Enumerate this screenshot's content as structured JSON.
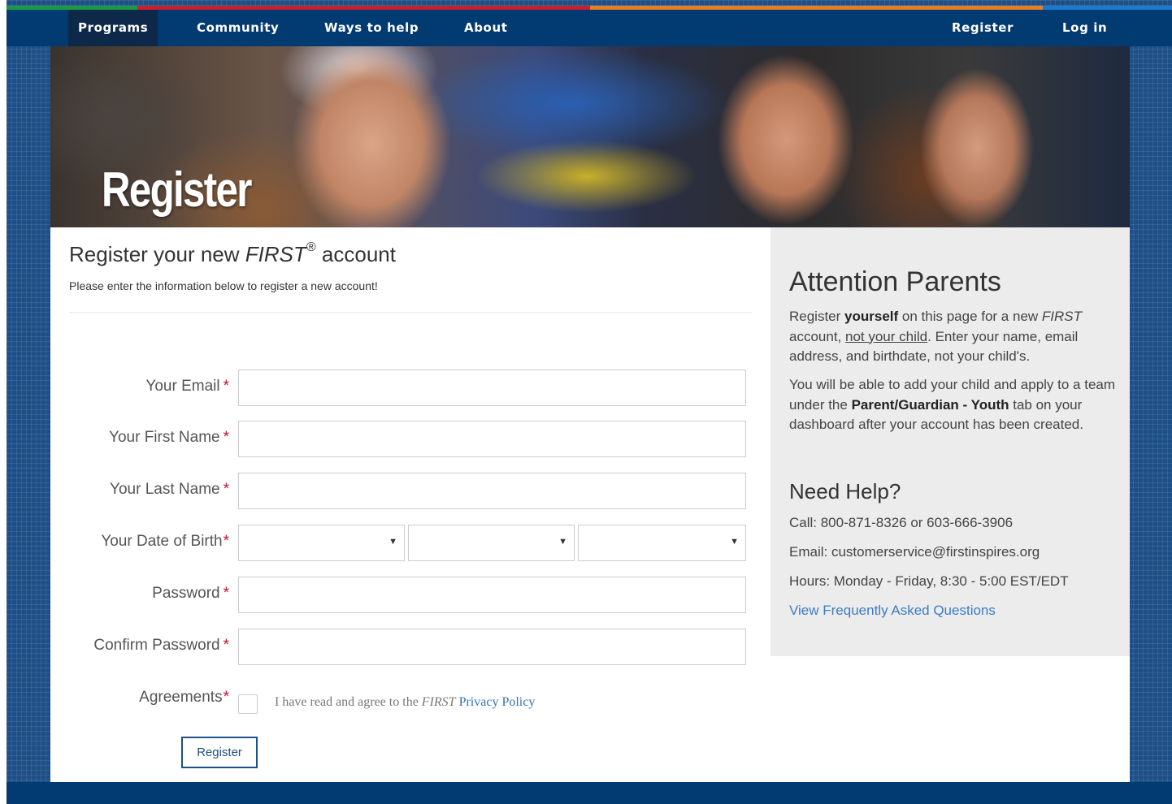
{
  "theme": {
    "nav_bg": "#023a72",
    "accent_blue": "#1e4f86",
    "link_color": "#3b7cc4",
    "required_color": "#c8102e",
    "stripe_colors": [
      "#1a9a46",
      "#c8202f",
      "#e97d27",
      "#1a7bd0"
    ]
  },
  "nav": {
    "left": [
      "Programs",
      "Community",
      "Ways to help",
      "About"
    ],
    "right": [
      "Register",
      "Log in"
    ],
    "active": "Programs"
  },
  "hero": {
    "title": "Register"
  },
  "form": {
    "heading_pre": "Register your new ",
    "heading_brand": "FIRST",
    "heading_mark": "®",
    "heading_post": " account",
    "subtitle": "Please enter the information below to register a new account!",
    "required_mark": "*",
    "fields": {
      "email": {
        "label": "Your Email",
        "value": ""
      },
      "first_name": {
        "label": "Your First Name",
        "value": ""
      },
      "last_name": {
        "label": "Your Last Name",
        "value": ""
      },
      "dob": {
        "label": "Your Date of Birth",
        "month": "",
        "day": "",
        "year": ""
      },
      "password": {
        "label": "Password",
        "value": ""
      },
      "confirm_password": {
        "label": "Confirm Password",
        "value": ""
      }
    },
    "agreements": {
      "label": "Agreements",
      "checked": false,
      "text_pre": "I have read and agree to the ",
      "brand": "FIRST",
      "link": "Privacy Policy"
    },
    "submit_label": "Register"
  },
  "sidebar": {
    "heading": "Attention Parents",
    "p1": {
      "a": "Register ",
      "b": "yourself",
      "c": " on this page for a new ",
      "d": "FIRST",
      "e": " account, ",
      "f": "not your child",
      "g": ". Enter your name, email address, and birthdate, not your child's."
    },
    "p2": {
      "a": "You will be able to add your child and apply to a team under the ",
      "b": "Parent/Guardian - Youth",
      "c": " tab on your dashboard after your account has been created."
    },
    "help_heading": "Need Help?",
    "call": "Call: 800-871-8326 or 603-666-3906",
    "email": "Email: customerservice@firstinspires.org",
    "hours": "Hours: Monday - Friday, 8:30 - 5:00 EST/EDT",
    "faq_link": "View Frequently Asked Questions"
  }
}
